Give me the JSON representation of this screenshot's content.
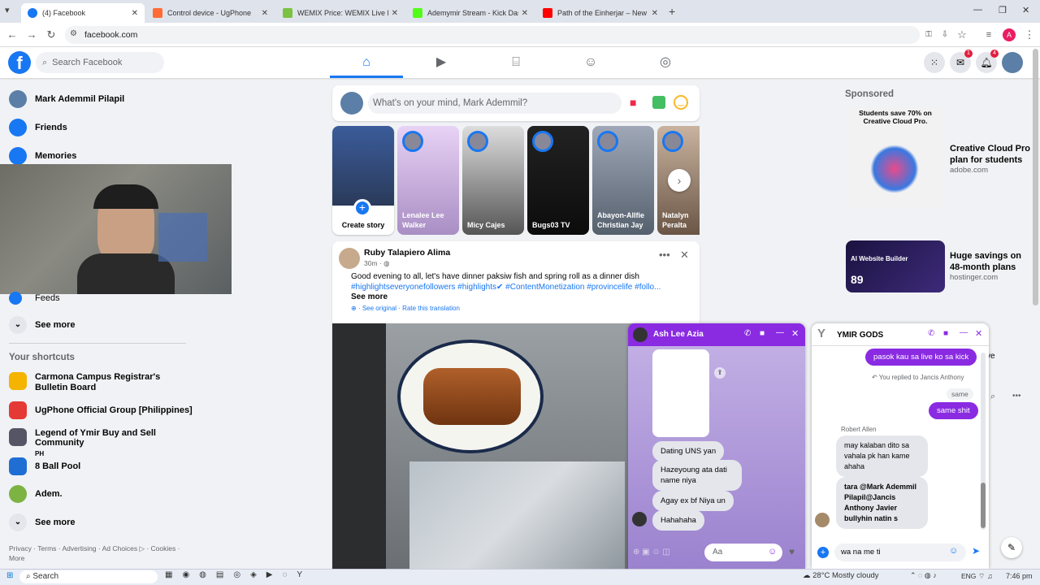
{
  "browser": {
    "tabs": [
      {
        "title": "(4) Facebook",
        "color": "#1877f2"
      },
      {
        "title": "Control device - UgPhone",
        "color": "#ff6b35"
      },
      {
        "title": "WEMIX Price: WEMIX Live Price",
        "color": "#7cc242"
      },
      {
        "title": "Ademymir Stream - Kick Dashb",
        "color": "#53fc18"
      },
      {
        "title": "Path of the Einherjar – New Sea",
        "color": "#ff0000"
      }
    ],
    "url": "facebook.com",
    "profile_initial": "A"
  },
  "facebook": {
    "search_placeholder": "Search Facebook",
    "notif_messenger": "1",
    "notif_bell": "4",
    "sidebar": {
      "user": "Mark Ademmil Pilapil",
      "items": [
        {
          "label": "Friends",
          "icon": "friends-icon"
        },
        {
          "label": "Memories",
          "icon": "clock-icon"
        },
        {
          "label": "Feeds",
          "icon": "feeds-icon"
        }
      ],
      "see_more": "See more",
      "shortcuts_heading": "Your shortcuts",
      "shortcuts": [
        {
          "label": "Carmona Campus Registrar's Bulletin Board"
        },
        {
          "label": "UgPhone Official Group [Philippines]"
        },
        {
          "label": "Legend of Ymir Buy and Sell Community",
          "sub": "PH"
        },
        {
          "label": "8 Ball Pool"
        },
        {
          "label": "Adem."
        }
      ],
      "see_more_2": "See more",
      "footer": "Privacy · Terms · Advertising · Ad Choices ▷ · Cookies · More"
    },
    "composer_placeholder": "What's on your mind, Mark Ademmil?",
    "stories": [
      {
        "name": "Create story"
      },
      {
        "name": "Lenalee Lee Walker"
      },
      {
        "name": "Micy Cajes"
      },
      {
        "name": "Bugs03 TV"
      },
      {
        "name": "Abayon-Allfie Christian Jay"
      },
      {
        "name": "Natalyn Peralta"
      }
    ],
    "post": {
      "author": "Ruby Talapiero Alima",
      "time": "30m · ",
      "text": "Good evening to all, let's have dinner paksiw fish and spring roll as a dinner dish",
      "hashtags": "#highlightseveryonefollowers #highlights✔ #ContentMonetization #provincelife #follo...",
      "see_more": "See more",
      "translate": "· See original · Rate this translation"
    },
    "sponsored": {
      "heading": "Sponsored",
      "ads": [
        {
          "title": "Creative Cloud Pro plan for students",
          "url": "adobe.com",
          "img_text": "Students save 70% on Creative Cloud Pro."
        },
        {
          "title": "Huge savings on 48-month plans",
          "url": "hostinger.com",
          "img_text": "AI Website Builder",
          "img_price": "89"
        }
      ]
    },
    "chat1": {
      "name": "Ash Lee Azia",
      "messages": [
        "Dating UNS yan",
        "Hazeyoung ata dati name niya",
        "Agay ex bf Niya un",
        "Hahahaha"
      ],
      "input_placeholder": "Aa"
    },
    "chat2": {
      "name": "YMIR GODS",
      "msg_me1": "pasok kau sa live ko sa kick",
      "reply_note": "You replied to Jancis Anthony",
      "reply_quote": "same",
      "msg_me2": "same shit",
      "sender": "Robert Allen",
      "msg_1": "may kalaban dito sa vahala pk han kame ahaha",
      "msg_2": "tara @Mark Ademmil Pilapil@Jancis Anthony Javier bullyhin natin s",
      "input_value": "wa na me ti",
      "overflow_text": "ve"
    }
  },
  "taskbar": {
    "search": "Search",
    "weather": "28°C  Mostly cloudy",
    "lang": "ENG",
    "time": "7:46 pm"
  },
  "colors": {
    "fb_blue": "#1877f2",
    "messenger_purple": "#8a2be2"
  }
}
